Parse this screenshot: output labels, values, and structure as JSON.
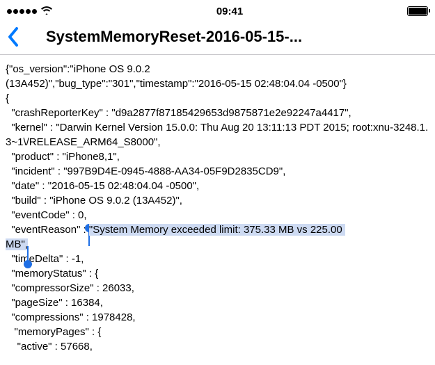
{
  "status": {
    "time": "09:41"
  },
  "nav": {
    "title": "SystemMemoryReset-2016-05-15-..."
  },
  "log": {
    "line00": "{\"os_version\":\"iPhone OS 9.0.2",
    "line01": "(13A452)\",\"bug_type\":\"301\",\"timestamp\":\"2016-05-15 02:48:04.04 -0500\"}",
    "line02": "{",
    "line03": "  \"crashReporterKey\" : \"d9a2877f87185429653d9875871e2e92247a4417\",",
    "line04": "  \"kernel\" : \"Darwin Kernel Version 15.0.0: Thu Aug 20 13:11:13 PDT 2015; root:xnu-3248.1.3~1\\/RELEASE_ARM64_S8000\",",
    "line05": "  \"product\" : \"iPhone8,1\",",
    "line06": "  \"incident\" : \"997B9D4E-0945-4888-AA34-05F9D2835CD9\",",
    "line07": "  \"date\" : \"2016-05-15 02:48:04.04 -0500\",",
    "line08": "  \"build\" : \"iPhone OS 9.0.2 (13A452)\",",
    "line09": "  \"eventCode\" : 0,",
    "line10_pre": "  \"eventReason\" : ",
    "line10_sel_a": "\"System Memory exceeded limit: 375.33 MB vs 225.00 ",
    "line10_sel_b": "MB\",",
    "line11": "  \"timeDelta\" : -1,",
    "line12": "  \"memoryStatus\" : {",
    "line13": "  \"compressorSize\" : 26033,",
    "line14": "  \"pageSize\" : 16384,",
    "line15": "  \"compressions\" : 1978428,",
    "line16": "   \"memoryPages\" : {",
    "line17": "    \"active\" : 57668,"
  }
}
